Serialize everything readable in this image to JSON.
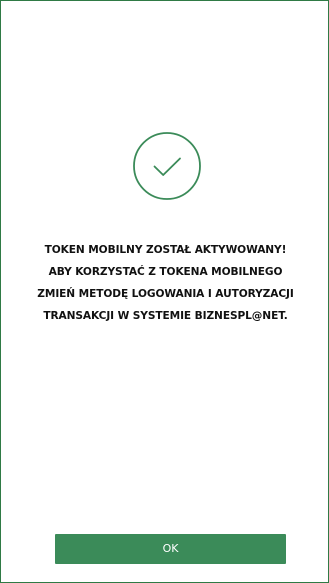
{
  "screen": {
    "icon": "check-circle-icon",
    "message_lines": [
      "TOKEN MOBILNY ZOSTAŁ AKTYWOWANY!",
      "ABY KORZYSTAĆ Z TOKENA MOBILNEGO",
      "ZMIEŃ METODĘ LOGOWANIA I AUTORYZACJI",
      "TRANSAKCJI W SYSTEMIE BIZNESPL@NET."
    ],
    "ok_label": "OK"
  },
  "colors": {
    "accent": "#3b8b59",
    "border": "#2f7a45",
    "text": "#111111",
    "background": "#ffffff"
  }
}
